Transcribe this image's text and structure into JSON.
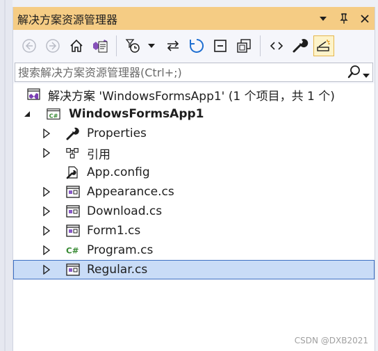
{
  "window": {
    "title": "解决方案资源管理器"
  },
  "toolbar": {
    "buttons": [
      {
        "icon": "back-arrow-icon"
      },
      {
        "icon": "forward-arrow-icon"
      },
      {
        "icon": "home-icon"
      },
      {
        "icon": "switch-views-icon"
      },
      {
        "icon": "pending-changes-filter-icon"
      },
      {
        "icon": "sync-with-active-document-icon"
      },
      {
        "icon": "refresh-icon"
      },
      {
        "icon": "collapse-all-icon"
      },
      {
        "icon": "show-all-files-icon"
      },
      {
        "icon": "view-code-icon"
      },
      {
        "icon": "properties-icon"
      },
      {
        "icon": "preview-selected-items-icon"
      }
    ]
  },
  "search": {
    "placeholder": "搜索解决方案资源管理器(Ctrl+;)"
  },
  "tree": {
    "solution": {
      "label": "解决方案 'WindowsFormsApp1' (1 个项目，共 1 个)"
    },
    "project": {
      "label": "WindowsFormsApp1"
    },
    "items": [
      {
        "label": "Properties",
        "icon": "wrench-icon",
        "expandable": true
      },
      {
        "label": "引用",
        "icon": "references-icon",
        "expandable": true
      },
      {
        "label": "App.config",
        "icon": "config-file-icon",
        "expandable": false
      },
      {
        "label": "Appearance.cs",
        "icon": "form-file-icon",
        "expandable": true
      },
      {
        "label": "Download.cs",
        "icon": "form-file-icon",
        "expandable": true
      },
      {
        "label": "Form1.cs",
        "icon": "form-file-icon",
        "expandable": true
      },
      {
        "label": "Program.cs",
        "icon": "csharp-file-icon",
        "expandable": true
      },
      {
        "label": "Regular.cs",
        "icon": "form-file-icon",
        "expandable": true,
        "selected": true
      }
    ]
  },
  "watermark": "CSDN @DXB2021",
  "colors": {
    "titlebar": "#f5cc84",
    "selection": "#c9dcf7",
    "selection_border": "#3d6fc2"
  }
}
